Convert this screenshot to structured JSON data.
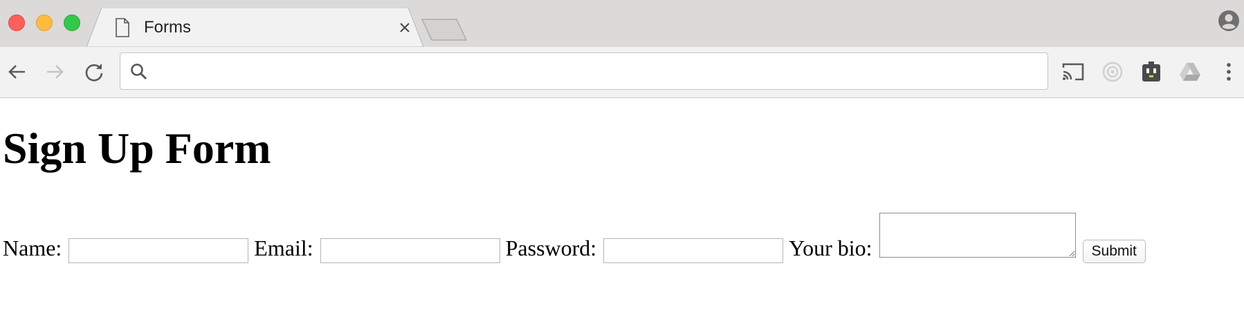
{
  "browser": {
    "tab": {
      "title": "Forms",
      "icon": "document-icon"
    },
    "toolbar": {
      "address_value": "",
      "icons": [
        "back-icon",
        "forward-icon",
        "reload-icon",
        "search-icon",
        "cast-icon",
        "extension-target-icon",
        "extension-outlet-icon",
        "google-drive-icon",
        "menu-dots-icon"
      ]
    },
    "colors": {
      "close": "#fc605b",
      "minimize": "#fdbc40",
      "maximize": "#34c84a"
    }
  },
  "page": {
    "heading": "Sign Up Form",
    "form": {
      "name_label": "Name:",
      "name_value": "",
      "email_label": "Email:",
      "email_value": "",
      "password_label": "Password:",
      "password_value": "",
      "bio_label": "Your bio:",
      "bio_value": "",
      "submit_label": "Submit"
    }
  }
}
